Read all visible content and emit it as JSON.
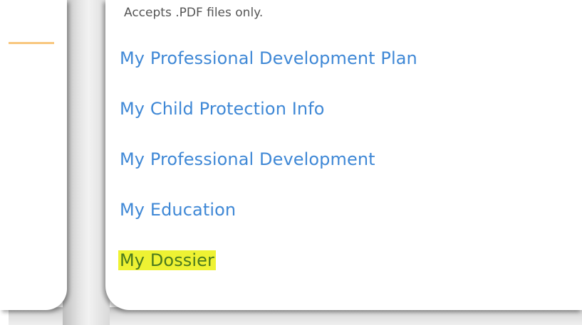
{
  "upload": {
    "note": "Accepts .PDF files only."
  },
  "nav": {
    "items": [
      {
        "label": "My Professional Development Plan"
      },
      {
        "label": "My Child Protection Info"
      },
      {
        "label": "My Professional Development"
      },
      {
        "label": "My Education"
      },
      {
        "label": "My Dossier",
        "highlighted": true
      }
    ]
  },
  "colors": {
    "link": "#3f88d6",
    "highlight": "#eef233",
    "accent": "#f8c77e"
  }
}
